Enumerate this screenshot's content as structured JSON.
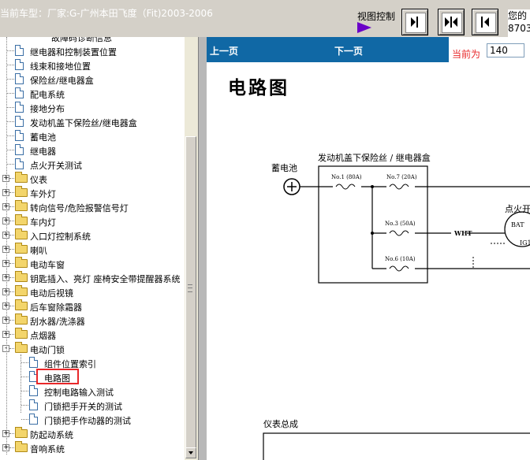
{
  "header": {
    "car_label": "当前车型：厂家:G-广州本田飞度（Fit)2003-2006",
    "view_control_label": "视图控制",
    "user_line1": "您的",
    "user_line2": "8703"
  },
  "view_buttons": [
    {
      "icon": "collapse-right-icon"
    },
    {
      "icon": "split-view-icon"
    },
    {
      "icon": "collapse-left-icon"
    }
  ],
  "tree": {
    "partial_top": "故障码诊断信息",
    "items": [
      {
        "type": "doc",
        "label": "继电器和控制装置位置",
        "indent": 1
      },
      {
        "type": "doc",
        "label": "线束和接地位置",
        "indent": 1
      },
      {
        "type": "doc",
        "label": "保险丝/继电器盒",
        "indent": 1
      },
      {
        "type": "doc",
        "label": "配电系统",
        "indent": 1
      },
      {
        "type": "doc",
        "label": "接地分布",
        "indent": 1
      },
      {
        "type": "doc",
        "label": "发动机盖下保险丝/继电器盒",
        "indent": 1
      },
      {
        "type": "doc",
        "label": "蓄电池",
        "indent": 1
      },
      {
        "type": "doc",
        "label": "继电器",
        "indent": 1
      },
      {
        "type": "doc",
        "label": "点火开关测试",
        "indent": 1
      },
      {
        "type": "folder",
        "label": "仪表",
        "indent": 0,
        "expand": "+"
      },
      {
        "type": "folder",
        "label": "车外灯",
        "indent": 0,
        "expand": "+"
      },
      {
        "type": "folder",
        "label": "转向信号/危险报警信号灯",
        "indent": 0,
        "expand": "+"
      },
      {
        "type": "folder",
        "label": "车内灯",
        "indent": 0,
        "expand": "+"
      },
      {
        "type": "folder",
        "label": "入口灯控制系统",
        "indent": 0,
        "expand": "+"
      },
      {
        "type": "folder",
        "label": "喇叭",
        "indent": 0,
        "expand": "+"
      },
      {
        "type": "folder",
        "label": "电动车窗",
        "indent": 0,
        "expand": "+"
      },
      {
        "type": "folder",
        "label": "钥匙插入、亮灯 座椅安全带提醒器系统",
        "indent": 0,
        "expand": "+"
      },
      {
        "type": "folder",
        "label": "电动后视镜",
        "indent": 0,
        "expand": "+"
      },
      {
        "type": "folder",
        "label": "后车窗除霜器",
        "indent": 0,
        "expand": "+"
      },
      {
        "type": "folder",
        "label": "刮水器/洗涤器",
        "indent": 0,
        "expand": "+"
      },
      {
        "type": "folder",
        "label": "点烟器",
        "indent": 0,
        "expand": "+"
      },
      {
        "type": "folder",
        "label": "电动门锁",
        "indent": 0,
        "expand": "-",
        "open": true
      },
      {
        "type": "doc",
        "label": "组件位置索引",
        "indent": 2
      },
      {
        "type": "doc",
        "label": "电路图",
        "indent": 2,
        "selected": true
      },
      {
        "type": "doc",
        "label": "控制电路输入测试",
        "indent": 2
      },
      {
        "type": "doc",
        "label": "门锁把手开关的测试",
        "indent": 2
      },
      {
        "type": "doc",
        "label": "门锁把手作动器的测试",
        "indent": 2
      },
      {
        "type": "folder",
        "label": "防起动系统",
        "indent": 0,
        "expand": "+"
      },
      {
        "type": "folder",
        "label": "音响系统",
        "indent": 0,
        "expand": "+"
      }
    ]
  },
  "nav": {
    "prev_label": "上一页",
    "next_label": "下一页",
    "current_label": "当前为",
    "current_page": "140"
  },
  "document": {
    "title": "电路图",
    "battery_label": "蓄电池",
    "box_label": "发动机盖下保险丝 / 继电器盒",
    "fuses": [
      "No.1 (80A)",
      "No.7 (20A)",
      "No.3 (50A)",
      "No.6 (10A)"
    ],
    "wire_label": "WHT",
    "switch_label": "点火开",
    "bat_label": "BAT",
    "ig_label": "IG1",
    "lower_label": "仪表总成"
  },
  "colors": {
    "navbar_bg": "#1068a5",
    "selection_box": "#e8282a",
    "view_arrow": "#6a00c8"
  }
}
